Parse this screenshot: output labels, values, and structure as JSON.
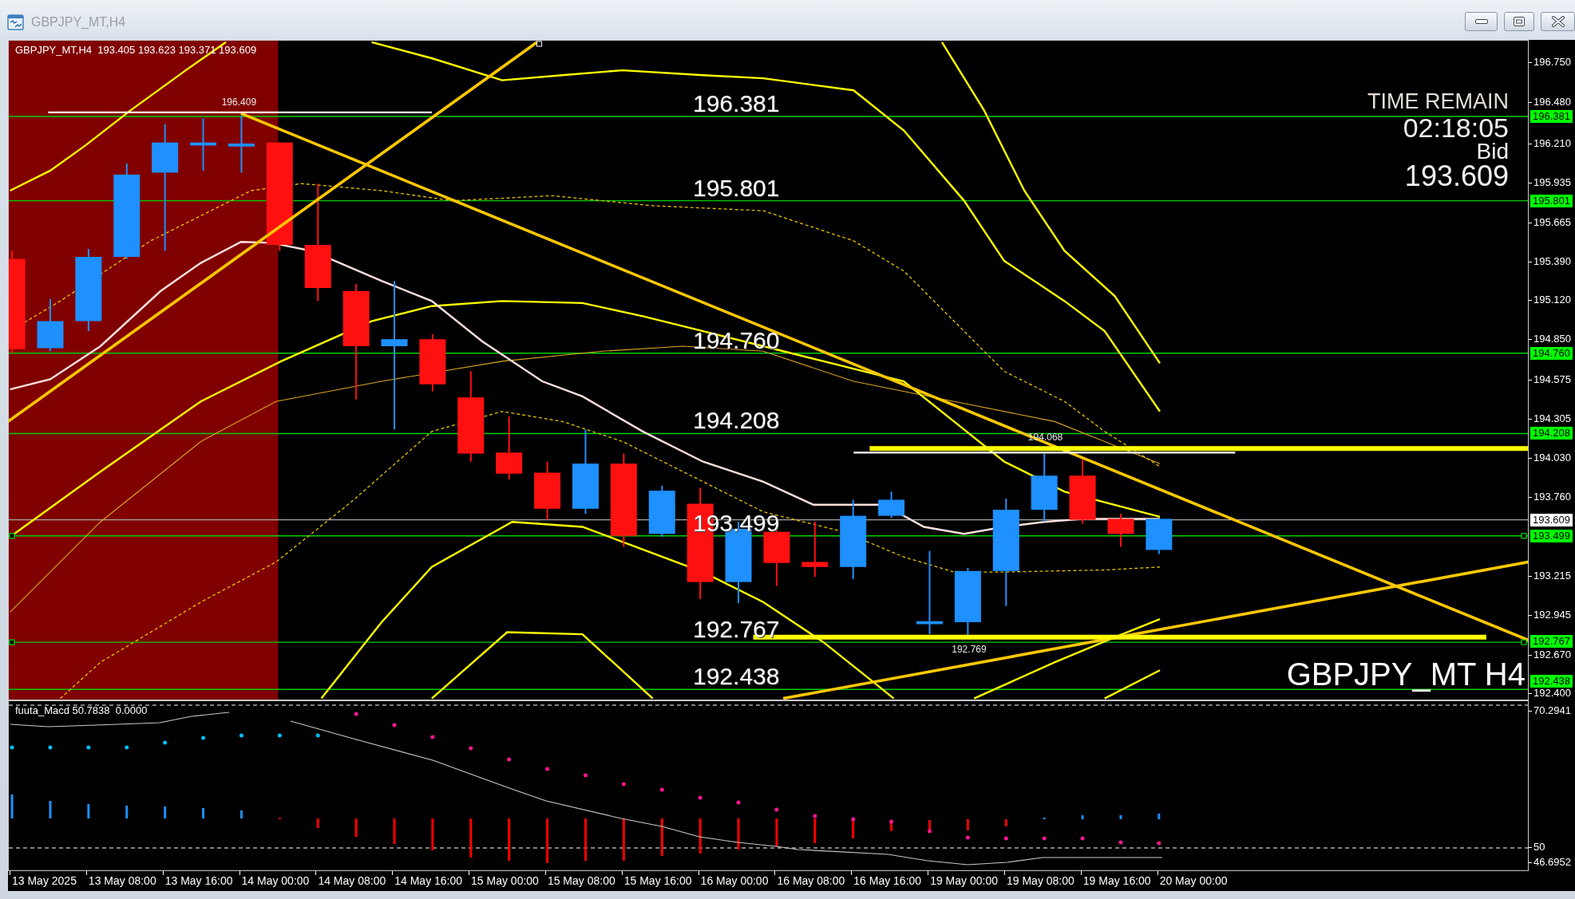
{
  "window": {
    "title": "GBPJPY_MT,H4",
    "active": false
  },
  "window_buttons": [
    {
      "kind": "minimize"
    },
    {
      "kind": "restore"
    },
    {
      "kind": "close"
    }
  ],
  "chart": {
    "info": "GBPJPY_MT,H4  193.405 193.623 193.371 193.609",
    "levels": [
      {
        "chart_label": "196.381",
        "axis_label": "196.381"
      },
      {
        "chart_label": "195.801",
        "axis_label": "195.801"
      },
      {
        "chart_label": "194.760",
        "axis_label": "194.760"
      },
      {
        "chart_label": "194.208",
        "axis_label": "194.208"
      },
      {
        "chart_label": "193.499",
        "axis_label": "193.499"
      },
      {
        "chart_label": "192.767",
        "axis_label": "192.767"
      },
      {
        "chart_label": "192.438",
        "axis_label": "192.438"
      }
    ],
    "bid_line": {
      "axis_label": "193.609"
    },
    "price_marks": [
      {
        "label": "196.409"
      },
      {
        "label": "194.068"
      },
      {
        "label": "192.769"
      }
    ],
    "countdown": {
      "title": "TIME REMAIN",
      "time": "02:18:05",
      "caption": "Bid",
      "price": "193.609"
    },
    "symbol_caption": "GBPJPY_MT H4",
    "price_axis": [
      "196.750",
      "196.480",
      "196.210",
      "195.935",
      "195.665",
      "195.390",
      "195.120",
      "194.850",
      "194.575",
      "194.305",
      "194.030",
      "193.760",
      "193.215",
      "192.945",
      "192.670",
      "192.400"
    ]
  },
  "indicator": {
    "info": "fuuta_Macd 50.7838  0.0000",
    "axis": [
      "70.2941",
      "50",
      "46.6952"
    ]
  },
  "time_axis": [
    "13 May 2025",
    "13 May 08:00",
    "13 May 16:00",
    "14 May 00:00",
    "14 May 08:00",
    "14 May 16:00",
    "15 May 00:00",
    "15 May 08:00",
    "15 May 16:00",
    "16 May 00:00",
    "16 May 08:00",
    "16 May 16:00",
    "19 May 00:00",
    "19 May 08:00",
    "19 May 16:00",
    "20 May 00:00"
  ]
}
